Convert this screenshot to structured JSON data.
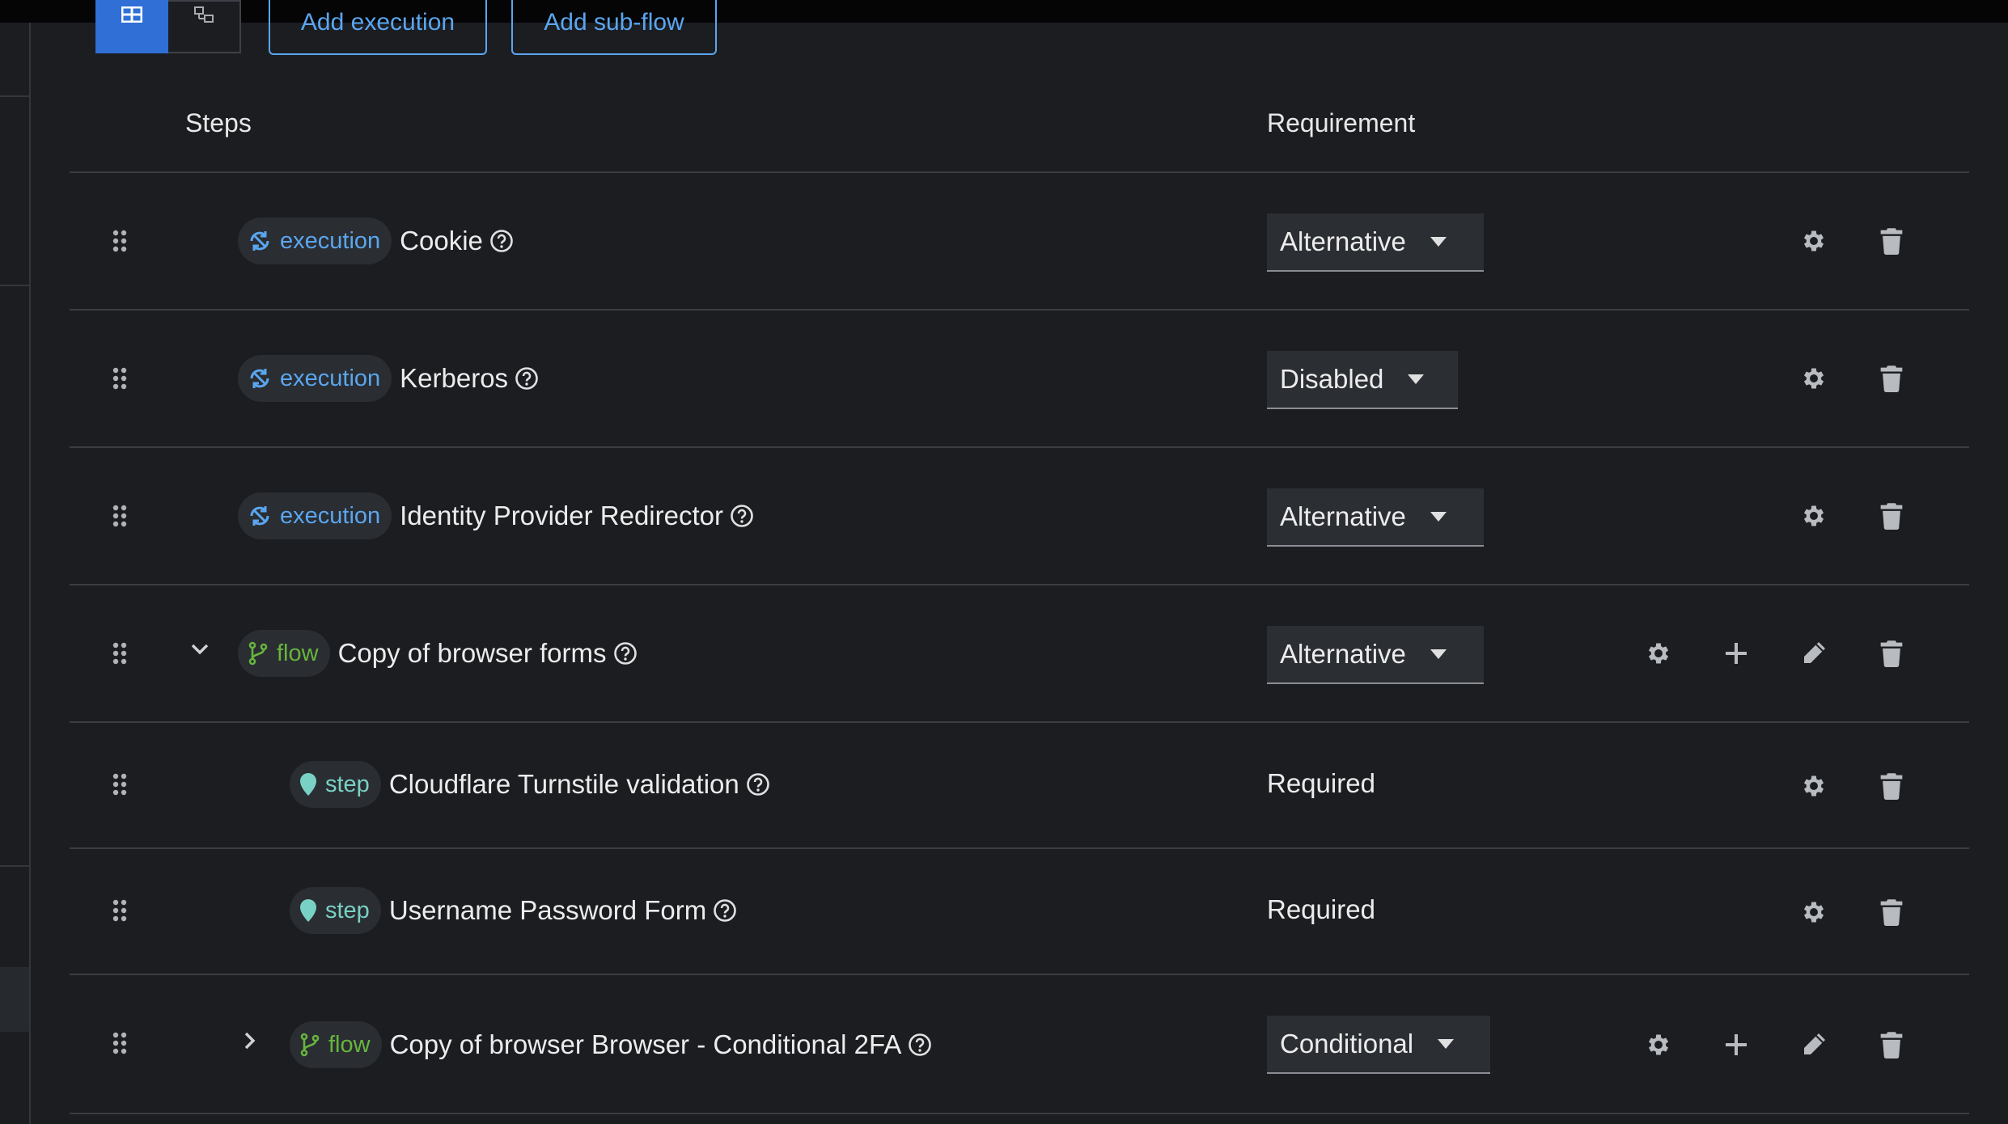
{
  "toolbar": {
    "add_execution": "Add execution",
    "add_subflow": "Add sub-flow"
  },
  "table": {
    "col_steps": "Steps",
    "col_requirement": "Requirement"
  },
  "rows": [
    {
      "badge": "execution",
      "name": "Cookie",
      "requirement": "Alternative"
    },
    {
      "badge": "execution",
      "name": "Kerberos",
      "requirement": "Disabled"
    },
    {
      "badge": "execution",
      "name": "Identity Provider Redirector",
      "requirement": "Alternative"
    },
    {
      "badge": "flow",
      "name": "Copy of browser forms",
      "requirement": "Alternative"
    },
    {
      "badge": "step",
      "name": "Cloudflare Turnstile validation",
      "requirement": "Required"
    },
    {
      "badge": "step",
      "name": "Username Password Form",
      "requirement": "Required"
    },
    {
      "badge": "flow",
      "name": "Copy of browser Browser - Conditional 2FA",
      "requirement": "Conditional"
    }
  ],
  "colors": {
    "accent": "#5aa6f0",
    "primary": "#2f6fd6",
    "flow": "#67b53e",
    "step": "#79d1c6",
    "background": "#1b1d21"
  }
}
